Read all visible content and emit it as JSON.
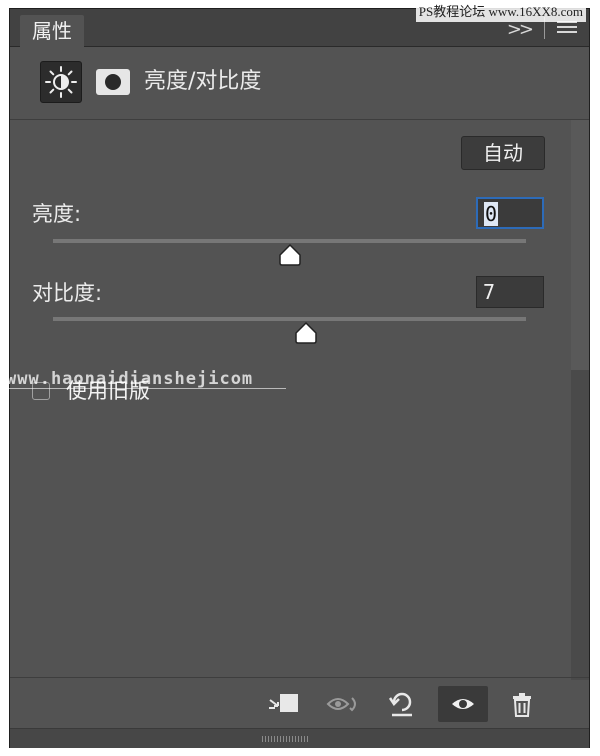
{
  "panel": {
    "tab_label": "属性",
    "collapse_glyph": ">>",
    "adjustment_title": "亮度/对比度"
  },
  "controls": {
    "auto_label": "自动",
    "brightness": {
      "label": "亮度:",
      "value": "0",
      "slider_value": 0
    },
    "contrast": {
      "label": "对比度:",
      "value": "7",
      "slider_value": 7
    },
    "legacy": {
      "label": "使用旧版",
      "checked": false
    }
  },
  "toolbar": {
    "icons": [
      "clip-to-layer-icon",
      "view-previous-state-icon",
      "reset-icon",
      "visibility-eye-icon",
      "delete-trash-icon"
    ]
  },
  "watermarks": {
    "top": "PS教程论坛 www.16XX8.com",
    "mid": "www.haonaidianshejicom"
  },
  "colors": {
    "panel_bg": "#535353",
    "focus_border": "#2d6bb8"
  }
}
